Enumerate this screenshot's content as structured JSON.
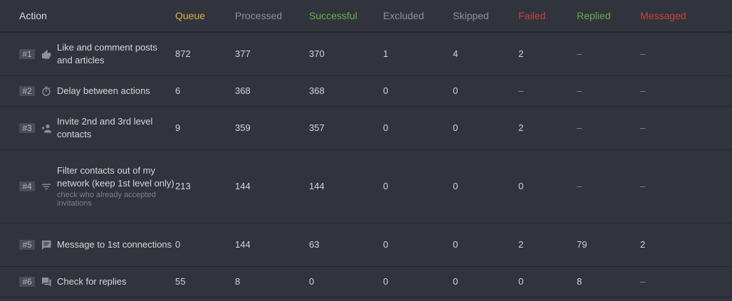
{
  "columns": {
    "action": {
      "label": "Action",
      "color": "#d9dbe0"
    },
    "queue": {
      "label": "Queue",
      "color": "#d7b14a"
    },
    "processed": {
      "label": "Processed",
      "color": "#8d9099"
    },
    "successful": {
      "label": "Successful",
      "color": "#66b04a"
    },
    "excluded": {
      "label": "Excluded",
      "color": "#8d9099"
    },
    "skipped": {
      "label": "Skipped",
      "color": "#8d9099"
    },
    "failed": {
      "label": "Failed",
      "color": "#c8423d"
    },
    "replied": {
      "label": "Replied",
      "color": "#66b04a"
    },
    "messaged": {
      "label": "Messaged",
      "color": "#c8423d"
    }
  },
  "rows": [
    {
      "index": "#1",
      "icon": "thumbs-up-icon",
      "label": "Like and comment posts and articles",
      "note": "",
      "queue": "872",
      "processed": "377",
      "successful": "370",
      "excluded": "1",
      "skipped": "4",
      "failed": "2",
      "replied": "–",
      "messaged": "–"
    },
    {
      "index": "#2",
      "icon": "timer-icon",
      "label": "Delay between actions",
      "note": "",
      "queue": "6",
      "processed": "368",
      "successful": "368",
      "excluded": "0",
      "skipped": "0",
      "failed": "–",
      "replied": "–",
      "messaged": "–"
    },
    {
      "index": "#3",
      "icon": "add-person-icon",
      "label": "Invite 2nd and 3rd level contacts",
      "note": "",
      "queue": "9",
      "processed": "359",
      "successful": "357",
      "excluded": "0",
      "skipped": "0",
      "failed": "2",
      "replied": "–",
      "messaged": "–"
    },
    {
      "index": "#4",
      "icon": "filter-icon",
      "label": "Filter contacts out of my network (keep 1st level only)",
      "note": "check who already accepted invitations",
      "queue": "213",
      "processed": "144",
      "successful": "144",
      "excluded": "0",
      "skipped": "0",
      "failed": "0",
      "replied": "–",
      "messaged": "–"
    },
    {
      "index": "#5",
      "icon": "message-icon",
      "label": "Message to 1st connections",
      "note": "",
      "queue": "0",
      "processed": "144",
      "successful": "63",
      "excluded": "0",
      "skipped": "0",
      "failed": "2",
      "replied": "79",
      "messaged": "2"
    },
    {
      "index": "#6",
      "icon": "chat-bubbles-icon",
      "label": "Check for replies",
      "note": "",
      "queue": "55",
      "processed": "8",
      "successful": "0",
      "excluded": "0",
      "skipped": "0",
      "failed": "0",
      "replied": "8",
      "messaged": "–"
    }
  ]
}
